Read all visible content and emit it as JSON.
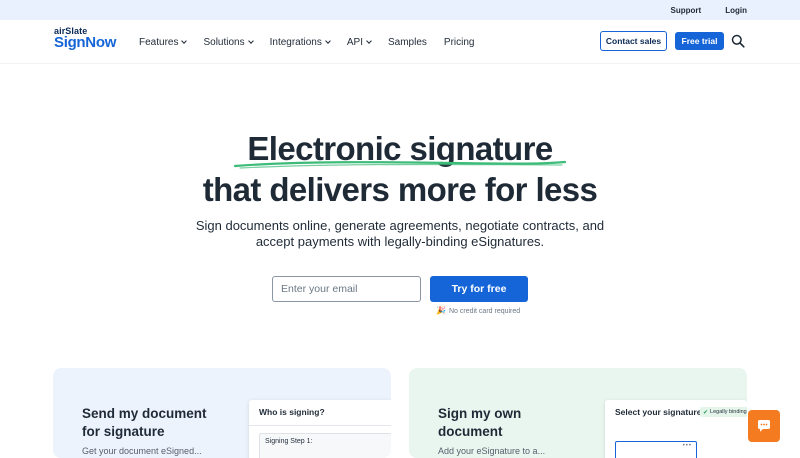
{
  "topbar": {
    "support": "Support",
    "login": "Login"
  },
  "logo": {
    "brand_small": "airSlate",
    "brand_big": "SignNow"
  },
  "nav": {
    "items": [
      {
        "label": "Features",
        "dropdown": true
      },
      {
        "label": "Solutions",
        "dropdown": true
      },
      {
        "label": "Integrations",
        "dropdown": true
      },
      {
        "label": "API",
        "dropdown": true
      },
      {
        "label": "Samples",
        "dropdown": false
      },
      {
        "label": "Pricing",
        "dropdown": false
      }
    ],
    "contact_sales": "Contact sales",
    "free_trial": "Free trial",
    "search_icon": "search-icon"
  },
  "hero": {
    "line1": "Electronic signature",
    "line2": "that delivers more for less",
    "subtitle": "Sign documents online, generate agreements, negotiate contracts, and accept payments with legally-binding eSignatures.",
    "email_placeholder": "Enter your email",
    "cta": "Try for free",
    "no_card": "No credit card required"
  },
  "cards": {
    "left": {
      "title_line1": "Send my document",
      "title_line2": "for signature",
      "desc": "Get your document eSigned...",
      "panel_title": "Who is signing?",
      "step_label": "Signing Step 1:"
    },
    "right": {
      "title_line1": "Sign my own",
      "title_line2": "document",
      "desc": "Add your eSignature to a...",
      "panel_title": "Select your signature",
      "badge": "Legally binding"
    }
  },
  "colors": {
    "accent": "#1565d8",
    "underline": "#3dbb78",
    "chat": "#f47b20",
    "topbar_bg": "#eaf1fe",
    "card_left_bg": "#edf3fd",
    "card_right_bg": "#e9f6ef"
  }
}
